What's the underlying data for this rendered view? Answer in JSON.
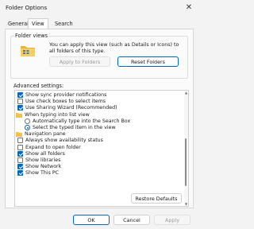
{
  "window": {
    "title": "Folder Options",
    "close_glyph": "✕"
  },
  "tabs": [
    {
      "label": "General"
    },
    {
      "label": "View"
    },
    {
      "label": "Search"
    }
  ],
  "folder_views": {
    "group_label": "Folder views",
    "description": "You can apply this view (such as Details or Icons) to all folders of this type.",
    "apply_button": "Apply to Folders",
    "reset_button": "Reset Folders",
    "icon": "folder-icon"
  },
  "advanced": {
    "label": "Advanced settings:",
    "items": [
      {
        "type": "checkbox",
        "checked": true,
        "label": "Show sync provider notifications"
      },
      {
        "type": "checkbox",
        "checked": false,
        "label": "Use check boxes to select items"
      },
      {
        "type": "checkbox",
        "checked": true,
        "label": "Use Sharing Wizard (Recommended)"
      },
      {
        "type": "folder",
        "label": "When typing into list view"
      },
      {
        "type": "radio",
        "checked": false,
        "label": "Automatically type into the Search Box"
      },
      {
        "type": "radio",
        "checked": true,
        "label": "Select the typed item in the view"
      },
      {
        "type": "folder",
        "label": "Navigation pane"
      },
      {
        "type": "checkbox",
        "checked": false,
        "label": "Always show availability status"
      },
      {
        "type": "checkbox",
        "checked": false,
        "label": "Expand to open folder"
      },
      {
        "type": "checkbox",
        "checked": true,
        "label": "Show all folders"
      },
      {
        "type": "checkbox",
        "checked": false,
        "label": "Show libraries"
      },
      {
        "type": "checkbox",
        "checked": true,
        "label": "Show Network"
      },
      {
        "type": "checkbox",
        "checked": true,
        "label": "Show This PC"
      }
    ]
  },
  "buttons": {
    "restore_defaults": "Restore Defaults",
    "ok": "OK",
    "cancel": "Cancel",
    "apply": "Apply"
  },
  "colors": {
    "accent": "#0067c0",
    "folder": "#f0c24b"
  }
}
